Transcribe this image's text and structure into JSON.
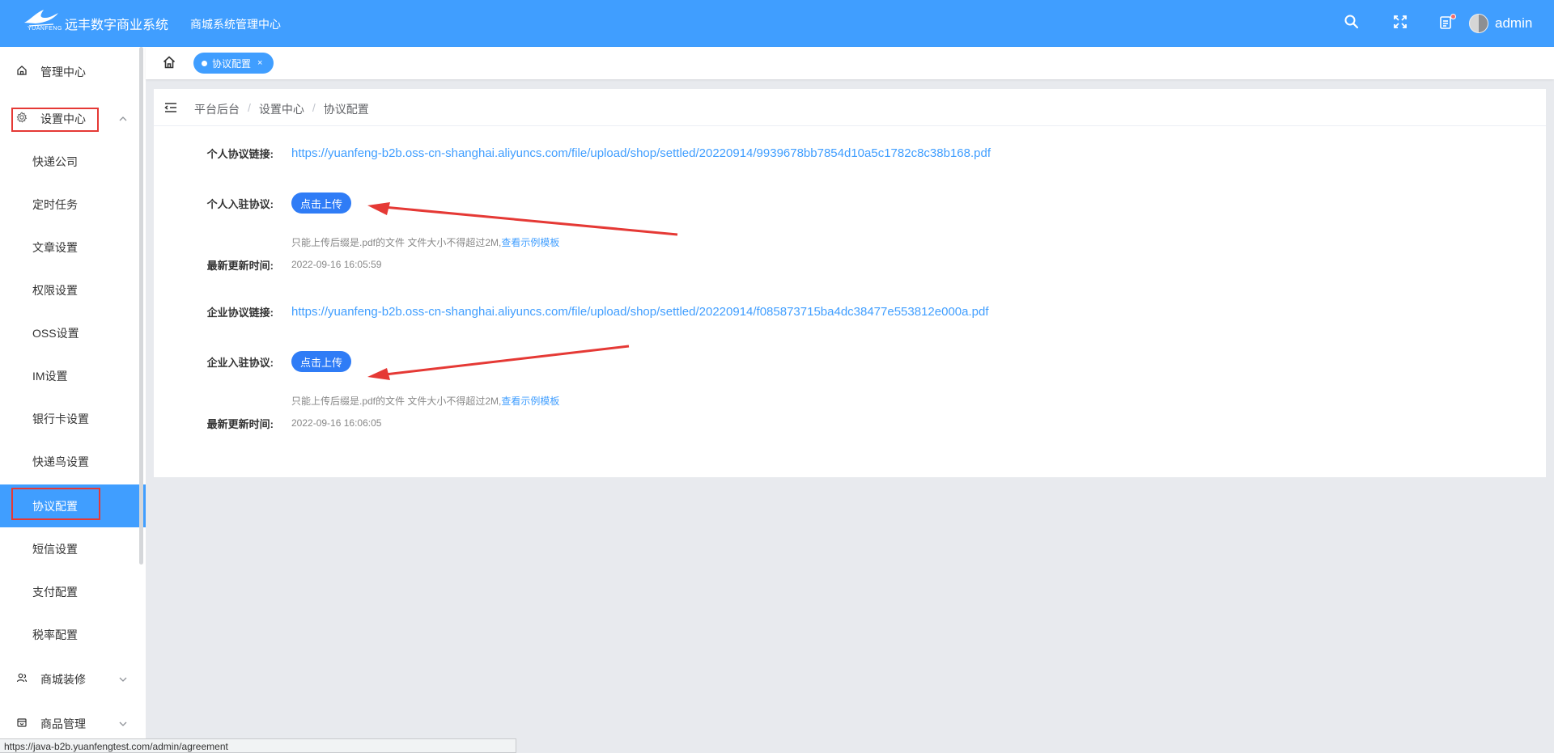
{
  "header": {
    "logo_text": "YUANFENG",
    "app_title": "远丰数字商业系统",
    "sub_title": "商城系统管理中心",
    "username": "admin"
  },
  "sidebar": {
    "items": [
      {
        "label": "管理中心",
        "icon": "home-icon"
      },
      {
        "label": "设置中心",
        "icon": "gear-icon",
        "expanded": true
      },
      {
        "label": "商城装修",
        "icon": "user-group-icon"
      },
      {
        "label": "商品管理",
        "icon": "box-icon"
      }
    ],
    "sub_items": [
      {
        "label": "快递公司"
      },
      {
        "label": "定时任务"
      },
      {
        "label": "文章设置"
      },
      {
        "label": "权限设置"
      },
      {
        "label": "OSS设置"
      },
      {
        "label": "IM设置"
      },
      {
        "label": "银行卡设置"
      },
      {
        "label": "快递鸟设置"
      },
      {
        "label": "协议配置",
        "active": true
      },
      {
        "label": "短信设置"
      },
      {
        "label": "支付配置"
      },
      {
        "label": "税率配置"
      }
    ]
  },
  "tabs": {
    "active_tab": "协议配置",
    "close_glyph": "×"
  },
  "breadcrumb": [
    "平台后台",
    "设置中心",
    "协议配置"
  ],
  "breadcrumb_sep": "/",
  "form": {
    "personal_link_label": "个人协议链接:",
    "personal_link": "https://yuanfeng-b2b.oss-cn-shanghai.aliyuncs.com/file/upload/shop/settled/20220914/9939678bb7854d10a5c1782c8c38b168.pdf",
    "personal_upload_label": "个人入驻协议:",
    "upload_button": "点击上传",
    "tip_text": "只能上传后缀是.pdf的文件 文件大小不得超过2M,",
    "tip_link": "查看示例模板",
    "update_label": "最新更新时间:",
    "personal_time": "2022-09-16 16:05:59",
    "enterprise_link_label": "企业协议链接:",
    "enterprise_link": "https://yuanfeng-b2b.oss-cn-shanghai.aliyuncs.com/file/upload/shop/settled/20220914/f085873715ba4dc38477e553812e000a.pdf",
    "enterprise_upload_label": "企业入驻协议:",
    "enterprise_time": "2022-09-16 16:06:05"
  },
  "status_bar_url": "https://java-b2b.yuanfengtest.com/admin/agreement",
  "colors": {
    "primary": "#409eff",
    "button": "#2f7cf6",
    "highlight_box": "#e53935",
    "annotation_arrow": "#e53935"
  }
}
